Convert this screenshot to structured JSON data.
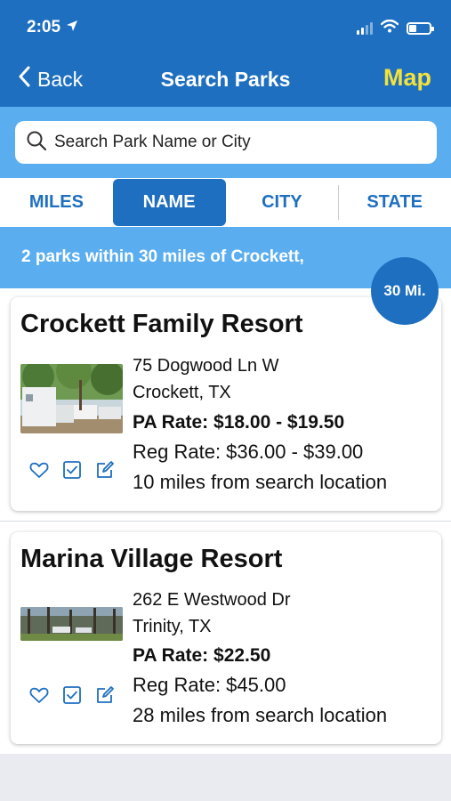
{
  "status": {
    "time": "2:05"
  },
  "nav": {
    "back_label": "Back",
    "title": "Search Parks",
    "map_label": "Map"
  },
  "search": {
    "placeholder": "Search Park Name or City"
  },
  "tabs": [
    {
      "label": "MILES",
      "active": false
    },
    {
      "label": "NAME",
      "active": true
    },
    {
      "label": "CITY",
      "active": false
    },
    {
      "label": "STATE",
      "active": false
    }
  ],
  "results": {
    "summary": "2 parks within 30 miles of Crockett,",
    "radius_badge": "30 Mi."
  },
  "parks": [
    {
      "name": "Crockett Family Resort",
      "address_line1": "75 Dogwood Ln W",
      "address_line2": "Crockett, TX",
      "pa_rate": "PA Rate: $18.00 - $19.50",
      "reg_rate": "Reg Rate: $36.00 - $39.00",
      "distance": "10 miles from search location"
    },
    {
      "name": "Marina Village Resort",
      "address_line1": "262 E Westwood Dr",
      "address_line2": "Trinity, TX",
      "pa_rate": "PA Rate: $22.50",
      "reg_rate": "Reg Rate: $45.00",
      "distance": "28 miles from search location"
    }
  ],
  "icons": {
    "status": [
      "location-arrow-icon",
      "signal-icon",
      "wifi-icon",
      "battery-icon"
    ],
    "nav": [
      "chevron-left-icon"
    ],
    "search": "search-icon",
    "card_actions": [
      "heart-icon",
      "checkbox-icon",
      "edit-icon"
    ]
  },
  "colors": {
    "primary": "#1e6fc0",
    "light_band": "#5aaef0",
    "map_accent": "#f4e23a"
  }
}
